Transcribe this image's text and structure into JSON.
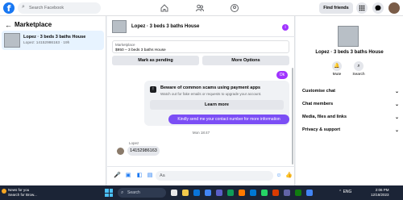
{
  "topbar": {
    "logo": "f",
    "search_placeholder": "Search Facebook",
    "find_friends": "Find friends"
  },
  "sidebar": {
    "title": "Marketplace",
    "back": "←",
    "item": {
      "title": "Lopez · 3 beds 3 baths House",
      "subtitle": "Lopez: 14152986163 · 19h"
    }
  },
  "chat": {
    "header_name": "Lopez · 3 beds 3 baths House",
    "badge": "i",
    "item_label": "Marketplace",
    "item_price": "$950 – 3 beds 3 baths House",
    "mark_pending": "Mark as pending",
    "more_options": "More Options",
    "ok_text": "Ok",
    "warning_title": "Beware of common scams using payment apps",
    "warning_sub": "Watch out for fake emails or requests to upgrade your account.",
    "learn_more": "Learn more",
    "sent_message": "Kindly send me your contact number for more information",
    "timestamp": "Mon 18:47",
    "sender": "Lopez",
    "received_message": "14152986163",
    "composer_placeholder": "Aa"
  },
  "right_panel": {
    "name": "Lopez · 3 beds 3 baths House",
    "mute": "Mute",
    "search": "Search",
    "rows": [
      "Customise chat",
      "Chat members",
      "Media, files and links",
      "Privacy & support"
    ]
  },
  "taskbar": {
    "news_line1": "News for you",
    "news_line2": "Search for Brow...",
    "search": "Search",
    "clock_time": "2:06 PM",
    "clock_date": "12/18/2023",
    "lang": "ENG"
  }
}
